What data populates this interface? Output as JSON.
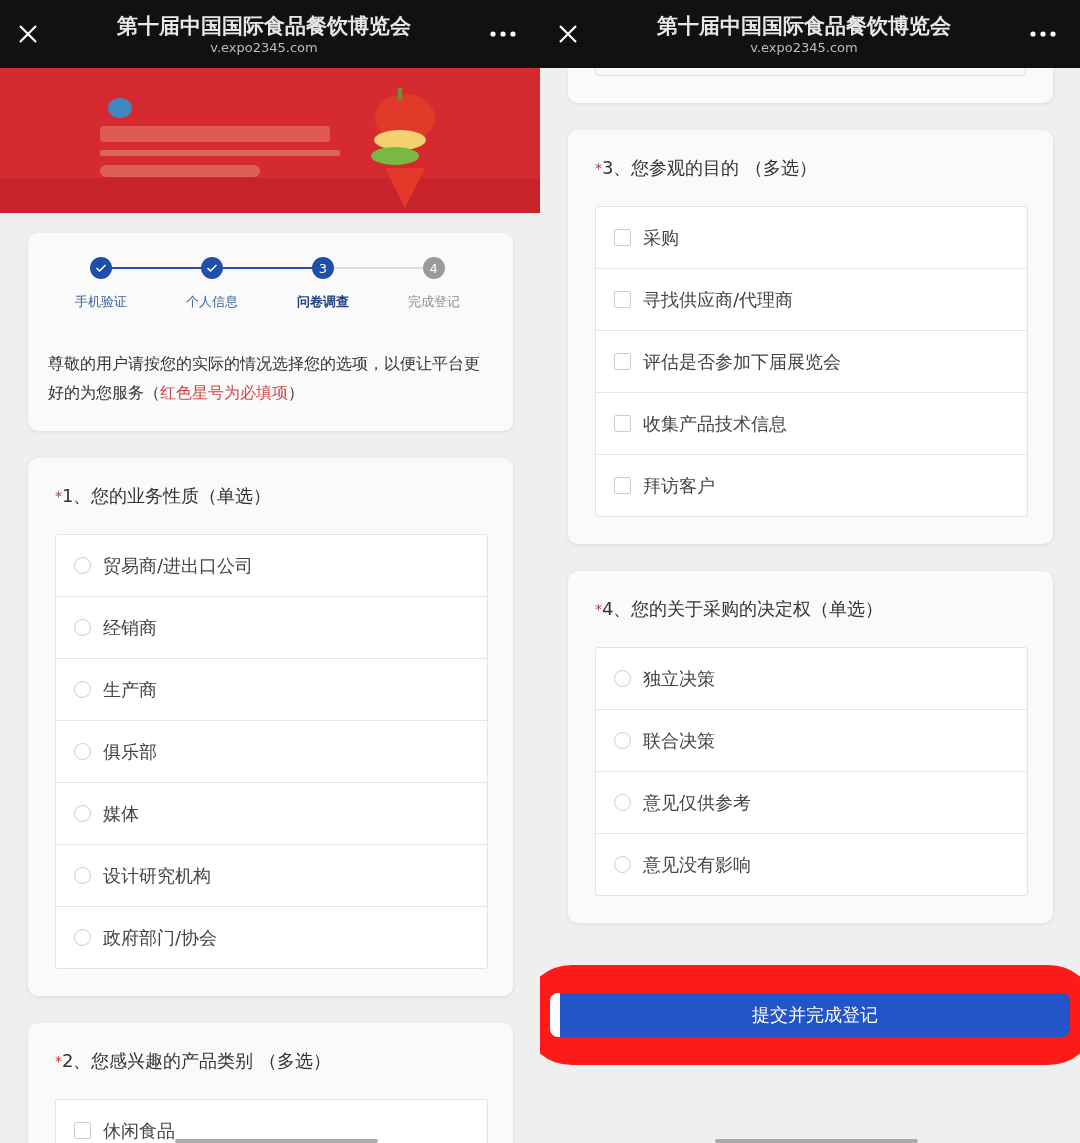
{
  "panes": [
    {
      "header": {
        "title": "第十届中国国际食品餐饮博览会",
        "url": "v.expo2345.com"
      },
      "banner": {
        "kind": "picture"
      },
      "steps": [
        {
          "label": "手机验证",
          "kind": "done"
        },
        {
          "label": "个人信息",
          "kind": "done"
        },
        {
          "label": "问卷调查",
          "number": "3",
          "kind": "current"
        },
        {
          "label": "完成登记",
          "number": "4",
          "kind": "todo"
        }
      ],
      "intro": {
        "before": "尊敬的用户请按您的实际的情况选择您的选项，以便让平台更好的为您服务（",
        "note": "红色星号为必填项",
        "after": "）"
      },
      "questions": [
        {
          "marker": "*",
          "title": "1、您的业务性质（单选）",
          "kind": "radio",
          "options": [
            {
              "label": "贸易商/进出口公司",
              "selected": false
            },
            {
              "label": "经销商",
              "selected": false
            },
            {
              "label": "生产商",
              "selected": false
            },
            {
              "label": "俱乐部",
              "selected": false
            },
            {
              "label": "媒体",
              "selected": false
            },
            {
              "label": "设计研究机构",
              "selected": false
            },
            {
              "label": "政府部门/协会",
              "selected": false
            }
          ]
        },
        {
          "marker": "*",
          "title": "2、您感兴趣的产品类别 （多选）",
          "kind": "checkbox",
          "options": [
            {
              "label": "休闲食品",
              "checked": false
            }
          ]
        }
      ]
    },
    {
      "header": {
        "title": "第十届中国国际食品餐饮博览会",
        "url": "v.expo2345.com"
      },
      "top_sliver": true,
      "questions": [
        {
          "marker": "*",
          "title": "3、您参观的目的 （多选）",
          "kind": "checkbox",
          "options": [
            {
              "label": "采购",
              "checked": false
            },
            {
              "label": "寻找供应商/代理商",
              "checked": false
            },
            {
              "label": "评估是否参加下届展览会",
              "checked": false
            },
            {
              "label": "收集产品技术信息",
              "checked": false
            },
            {
              "label": "拜访客户",
              "checked": false
            }
          ]
        },
        {
          "marker": "*",
          "title": "4、您的关于采购的决定权（单选）",
          "kind": "radio",
          "options": [
            {
              "label": "独立决策",
              "selected": false
            },
            {
              "label": "联合决策",
              "selected": false
            },
            {
              "label": "意见仅供参考",
              "selected": false
            },
            {
              "label": "意见没有影响",
              "selected": false
            }
          ]
        }
      ],
      "submit": {
        "label": "提交并完成登记",
        "highlighted": true
      }
    }
  ]
}
